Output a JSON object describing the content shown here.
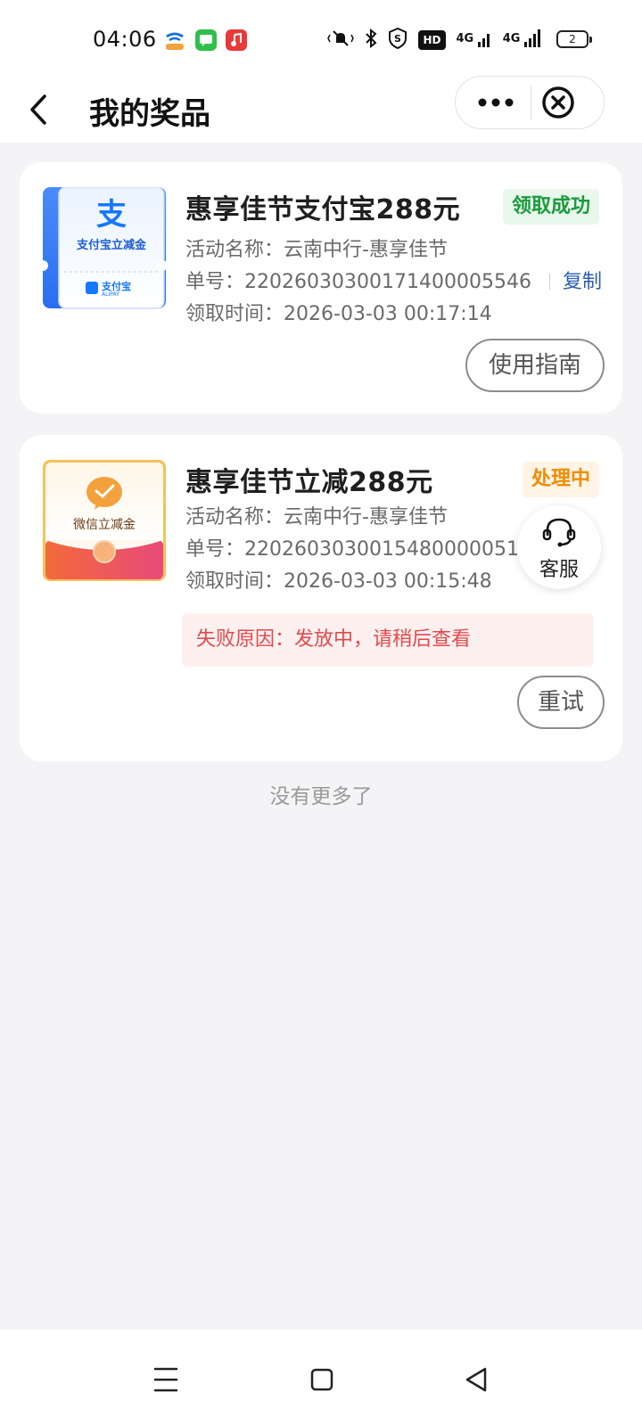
{
  "status_bar": {
    "time": "04:06",
    "app_icons": [
      "china-telecom-icon",
      "messages-icon",
      "music-icon"
    ],
    "hd_label": "HD",
    "signal1": "4G",
    "signal2": "4G",
    "battery": "2"
  },
  "header": {
    "title": "我的奖品"
  },
  "prizes": [
    {
      "title": "惠享佳节支付宝288元",
      "status": "领取成功",
      "thumb_label": "支付宝立减金",
      "thumb_brand": "支付宝",
      "thumb_brand_en": "ALIPAY",
      "activity_label": "活动名称：",
      "activity": "云南中行-惠享佳节",
      "order_label": "单号：",
      "order": "2202603030017140000554​6",
      "copy": "复制",
      "time_label": "领取时间：",
      "time": "2026-03-03 00:17:14",
      "action": "使用指南"
    },
    {
      "title": "惠享佳节立减288元",
      "status": "处理中",
      "thumb_label": "微信立减金",
      "activity_label": "活动名称：",
      "activity": "云南中行-惠享佳节",
      "order_label": "单号：",
      "order": "2202603030015480000051​8",
      "time_label": "领取时间：",
      "time": "2026-03-03 00:15:48",
      "fail_reason": "失败原因：发放中，请稍后查看",
      "action": "重试"
    }
  ],
  "customer_service": "客服",
  "no_more": "没有更多了",
  "colors": {
    "success": "#1a9b3c",
    "processing": "#f08c00",
    "error": "#e2494b",
    "link": "#2a5dae",
    "alipay_blue": "#1677ff"
  }
}
